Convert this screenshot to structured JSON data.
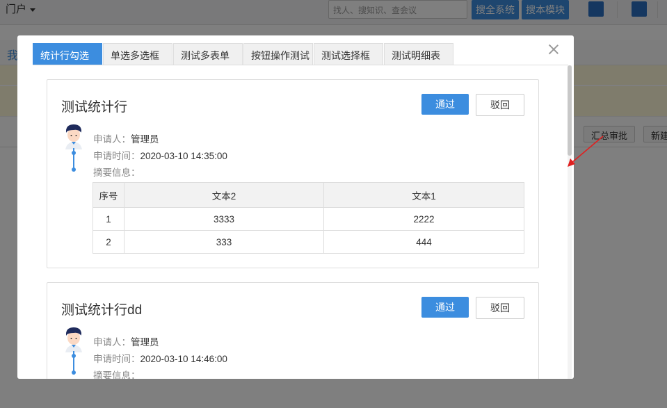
{
  "background": {
    "portal_label": "门户",
    "search_placeholder": "找人、搜知识、查会议",
    "search_all_label": "搜全系统",
    "search_module_label": "搜本模块",
    "partial_text_wo": "我",
    "summary_approve_label": "汇总审批",
    "new_label": "新建"
  },
  "modal": {
    "tabs": [
      {
        "label": "统计行勾选"
      },
      {
        "label": "单选多选框"
      },
      {
        "label": "测试多表单"
      },
      {
        "label": "按钮操作测试"
      },
      {
        "label": "测试选择框"
      },
      {
        "label": "测试明细表"
      }
    ],
    "cards": [
      {
        "title": "测试统计行",
        "pass_label": "通过",
        "reject_label": "驳回",
        "applicant_label": "申请人：",
        "applicant": "管理员",
        "time_label": "申请时间：",
        "time": "2020-03-10 14:35:00",
        "summary_label": "摘要信息：",
        "table": {
          "headers": [
            "序号",
            "文本2",
            "文本1"
          ],
          "rows": [
            [
              "1",
              "3333",
              "2222"
            ],
            [
              "2",
              "333",
              "444"
            ]
          ]
        }
      },
      {
        "title": "测试统计行dd",
        "pass_label": "通过",
        "reject_label": "驳回",
        "applicant_label": "申请人：",
        "applicant": "管理员",
        "time_label": "申请时间：",
        "time": "2020-03-10 14:46:00",
        "summary_label": "摘要信息："
      }
    ]
  },
  "colors": {
    "primary": "#3c8ddf",
    "overlay": "rgba(0,0,0,0.5)",
    "annotation_arrow": "#e02020"
  }
}
